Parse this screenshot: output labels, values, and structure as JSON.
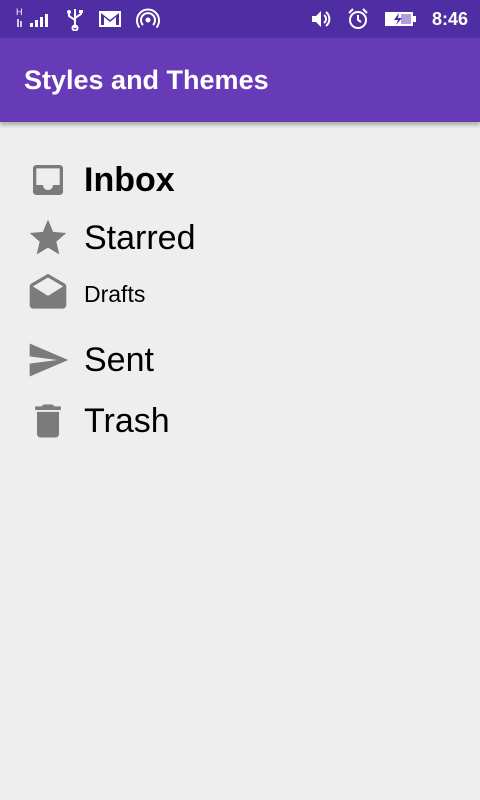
{
  "status_bar": {
    "network_type": "H",
    "time": "8:46",
    "icons": [
      "signal-icon",
      "usb-icon",
      "gmail-icon",
      "hotspot-icon",
      "volume-icon",
      "alarm-icon",
      "battery-icon"
    ]
  },
  "app_bar": {
    "title": "Styles and Themes"
  },
  "colors": {
    "status_bar": "#4f2ea3",
    "app_bar": "#673ab7",
    "background": "#eeeeee",
    "icon_gray": "#7b7b7b"
  },
  "items": [
    {
      "label": "Inbox",
      "icon": "inbox-icon"
    },
    {
      "label": "Starred",
      "icon": "star-icon"
    },
    {
      "label": "Drafts",
      "icon": "drafts-icon"
    },
    {
      "label": "Sent",
      "icon": "send-icon"
    },
    {
      "label": "Trash",
      "icon": "trash-icon"
    }
  ]
}
